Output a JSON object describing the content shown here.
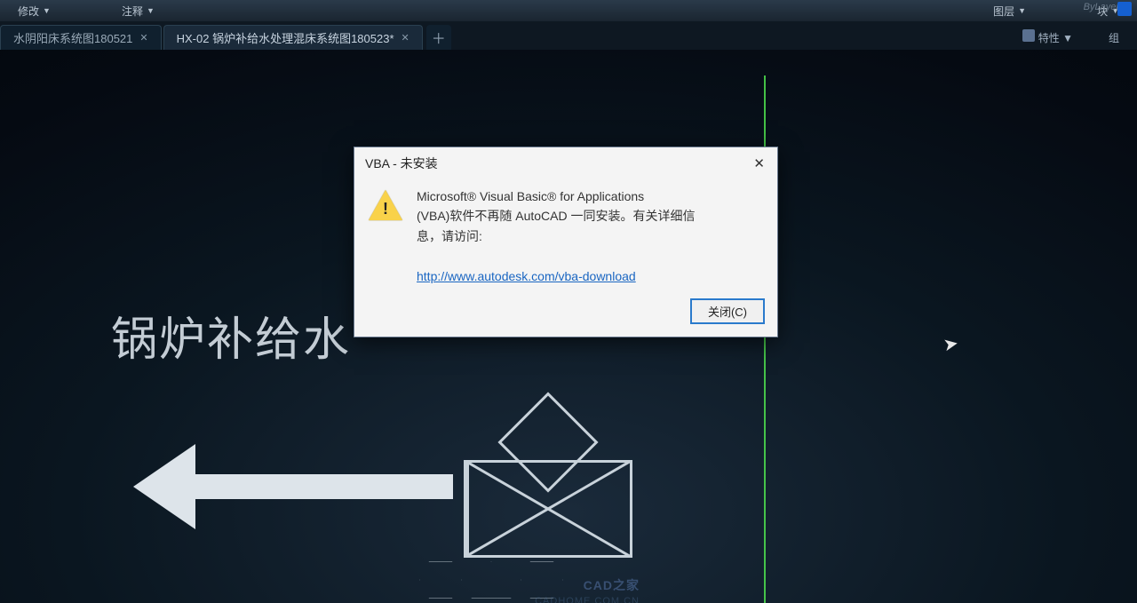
{
  "ribbon": {
    "group1": "修改",
    "group2": "注释",
    "group3": "图层",
    "group4": "块",
    "group5_left_label": "特性",
    "group5_right_label": "组",
    "faded_right": "ByLayer"
  },
  "tabs": {
    "tab1": "水阴阳床系统图180521",
    "tab2": "HX-02 锅炉补给水处理混床系统图180523*",
    "right_label": "特性",
    "right_label2": "组"
  },
  "canvas": {
    "title_text": "锅炉补给水"
  },
  "dialog": {
    "title": "VBA - 未安装",
    "msg_line1": "Microsoft® Visual Basic® for Applications",
    "msg_line2": "(VBA)软件不再随 AutoCAD 一同安装。有关详细信",
    "msg_line3": "息，请访问:",
    "link": "http://www.autodesk.com/vba-download",
    "close_btn": "关闭(C)"
  },
  "watermark": {
    "line1": "CAD之家",
    "line2": "CADHOME.COM.CN"
  }
}
